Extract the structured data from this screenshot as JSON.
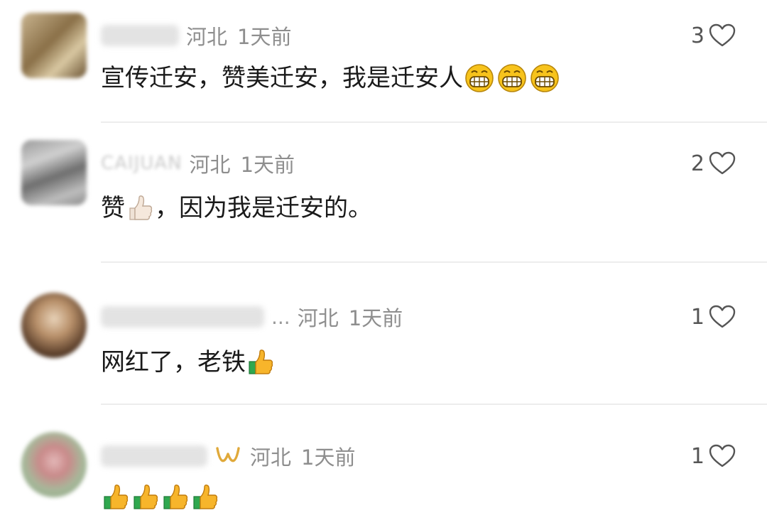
{
  "comments": [
    {
      "location": "河北",
      "time": "1天前",
      "text_parts": [
        "宣传迁安，赞美迁安，我是迁安人"
      ],
      "emojis": [
        "grin-icon",
        "grin-icon",
        "grin-icon"
      ],
      "likes": "3"
    },
    {
      "name_text": "CAIJUAN",
      "location": "河北",
      "time": "1天前",
      "text_parts": [
        "赞",
        "，因为我是迁安的。"
      ],
      "emojis": [
        "thumbs-up-light-icon"
      ],
      "likes": "2"
    },
    {
      "ellipsis": "...",
      "location": "河北",
      "time": "1天前",
      "text_parts": [
        "网红了，老铁"
      ],
      "emojis": [
        "thumbs-up-icon"
      ],
      "likes": "1"
    },
    {
      "location": "河北",
      "time": "1天前",
      "text_parts": [],
      "emojis": [
        "thumbs-up-icon",
        "thumbs-up-icon",
        "thumbs-up-icon",
        "thumbs-up-icon"
      ],
      "likes": "1"
    }
  ],
  "colors": {
    "meta_gray": "#8e8e8e",
    "divider": "#ededed",
    "vip_gold": "#e0a93a",
    "emoji_yellow": "#f7c31c"
  }
}
